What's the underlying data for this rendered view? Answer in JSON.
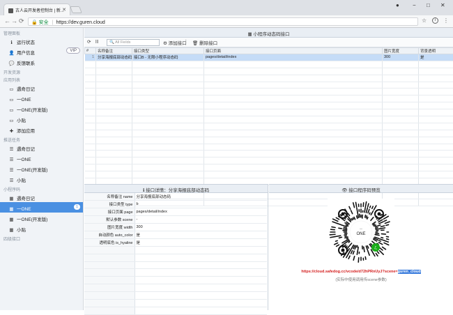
{
  "browser": {
    "tab_title": "古人云开发者控制台 | 新...",
    "url_secure_label": "安全",
    "url": "https://dev.guren.cloud",
    "minimize": "−",
    "maximize": "□",
    "close": "✕"
  },
  "sidebar": {
    "sections": [
      {
        "title": "管理面板",
        "items": [
          {
            "label": "运行状态",
            "icon": "info-icon",
            "glyph": "ℹ"
          },
          {
            "label": "用户信息",
            "icon": "user-icon",
            "glyph": "👤",
            "badge": "VIP"
          },
          {
            "label": "反馈联系",
            "icon": "chat-icon",
            "glyph": "💬"
          }
        ]
      },
      {
        "title": "开发资源",
        "items": []
      },
      {
        "title": "应用列表",
        "items": [
          {
            "label": "遇奇日记",
            "icon": "inbox-icon",
            "glyph": "▭"
          },
          {
            "label": "一ONE",
            "icon": "inbox-icon",
            "glyph": "▭"
          },
          {
            "label": "一ONE(开发版)",
            "icon": "inbox-icon",
            "glyph": "▭"
          },
          {
            "label": "小贴",
            "icon": "inbox-icon",
            "glyph": "▭"
          },
          {
            "label": "添加应用",
            "icon": "plus-icon",
            "glyph": "✚"
          }
        ]
      },
      {
        "title": "推送任务",
        "items": [
          {
            "label": "遇奇日记",
            "icon": "list-icon",
            "glyph": "☰"
          },
          {
            "label": "一ONE",
            "icon": "list-icon",
            "glyph": "☰"
          },
          {
            "label": "一ONE(开发版)",
            "icon": "list-icon",
            "glyph": "☰"
          },
          {
            "label": "小贴",
            "icon": "list-icon",
            "glyph": "☰"
          }
        ]
      },
      {
        "title": "小程序码",
        "items": [
          {
            "label": "遇奇日记",
            "icon": "qrcode-icon",
            "glyph": "▦"
          },
          {
            "label": "一ONE",
            "icon": "qrcode-icon",
            "glyph": "▦",
            "active": true,
            "count": "1"
          },
          {
            "label": "一ONE(开发版)",
            "icon": "qrcode-icon",
            "glyph": "▦"
          },
          {
            "label": "小贴",
            "icon": "qrcode-icon",
            "glyph": "▦"
          }
        ]
      },
      {
        "title": "四级接口",
        "items": []
      }
    ]
  },
  "main": {
    "title": "小程序动态码接口",
    "toolbar": {
      "refresh": "⟳",
      "columns": "|||",
      "search_placeholder": "All Fields",
      "add": "添加接口",
      "delete": "删除接口"
    },
    "table": {
      "headers": [
        "#",
        "名称备注",
        "接口类型",
        "接口页面",
        "图片宽度",
        "背景透明"
      ],
      "rows": [
        [
          "1",
          "分享海报底部动态码",
          "接口B - 无限小程序动态码",
          "pages/detail/index",
          "300",
          "是"
        ]
      ],
      "empty_rows": 21
    }
  },
  "detail": {
    "title": "接口详情：分享海报底部动态码",
    "rows": [
      {
        "key": "名称备注 name",
        "value": "分享海报底部动态码"
      },
      {
        "key": "接口类型 type",
        "value": "b"
      },
      {
        "key": "接口页面 page",
        "value": "pages/detail/index"
      },
      {
        "key": "默认参数 scene",
        "value": "-"
      },
      {
        "key": "图片宽度 width",
        "value": "300"
      },
      {
        "key": "自动颜色 auto_color",
        "value": "是"
      },
      {
        "key": "透明底色 is_hyaline",
        "value": "是"
      }
    ],
    "empty_rows": 9
  },
  "preview": {
    "title": "接口程序码预览",
    "qr_center": "ONE",
    "url_prefix": "https://cloud.safedog.cc/vcode/d72hPRnUyJ?scene=",
    "url_highlight": "guren_cloud",
    "note": "(实际中使用调用传scene参数)"
  },
  "colors": {
    "accent": "#4a90e2",
    "selected_row": "#c5dcf7",
    "url_red": "#d42020",
    "secure_green": "#0a8a3c"
  }
}
